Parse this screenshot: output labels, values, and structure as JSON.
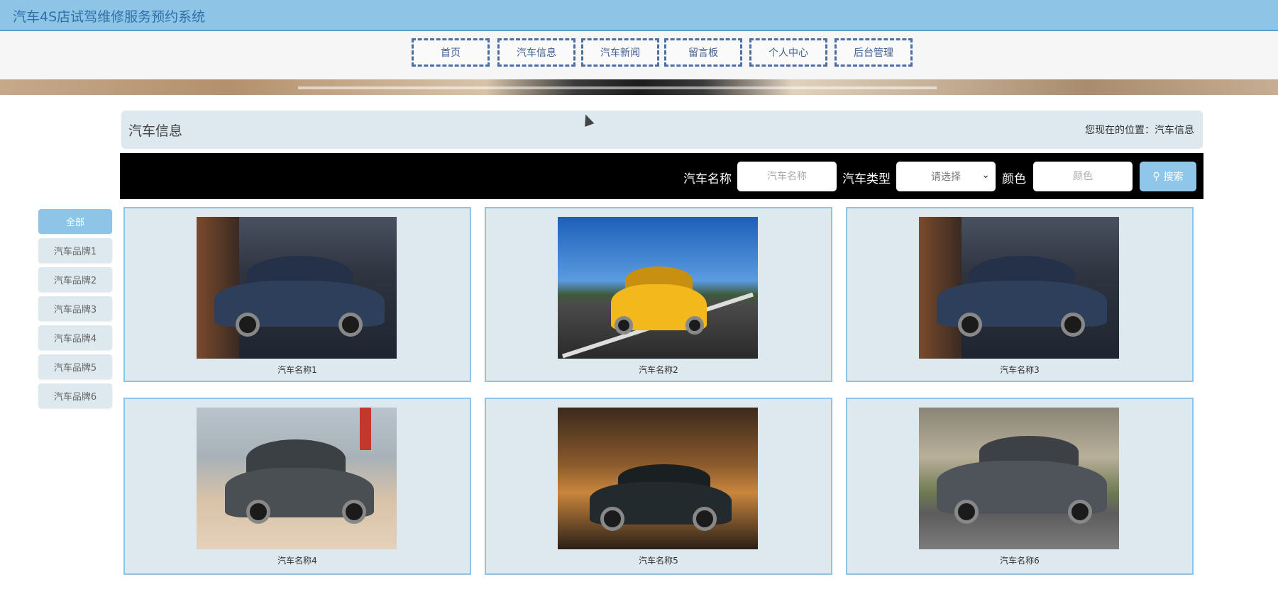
{
  "header": {
    "site_title": "汽车4S店试驾维修服务预约系统"
  },
  "nav": [
    "首页",
    "汽车信息",
    "汽车新闻",
    "留言板",
    "个人中心",
    "后台管理"
  ],
  "section": {
    "title": "汽车信息",
    "breadcrumb": "您现在的位置：汽车信息"
  },
  "search": {
    "name_label": "汽车名称",
    "name_placeholder": "汽车名称",
    "type_label": "汽车类型",
    "type_selected": "请选择",
    "color_label": "颜色",
    "color_placeholder": "颜色",
    "button_label": "搜索",
    "button_icon": "search-icon"
  },
  "sidebar": [
    "全部",
    "汽车品牌1",
    "汽车品牌2",
    "汽车品牌3",
    "汽车品牌4",
    "汽车品牌5",
    "汽车品牌6"
  ],
  "cars": [
    {
      "name": "汽车名称1",
      "color": "#2e3f5c"
    },
    {
      "name": "汽车名称2",
      "color": "#f3b81c"
    },
    {
      "name": "汽车名称3",
      "color": "#2e3f5c"
    },
    {
      "name": "汽车名称4",
      "color": "#4a4f54"
    },
    {
      "name": "汽车名称5",
      "color": "#232a2e"
    },
    {
      "name": "汽车名称6",
      "color": "#4f545a"
    }
  ],
  "colors": {
    "topbar": "#8ec5e6",
    "panel": "#dde9ee",
    "search_bar": "#000000",
    "accent": "#8fc6e9"
  }
}
